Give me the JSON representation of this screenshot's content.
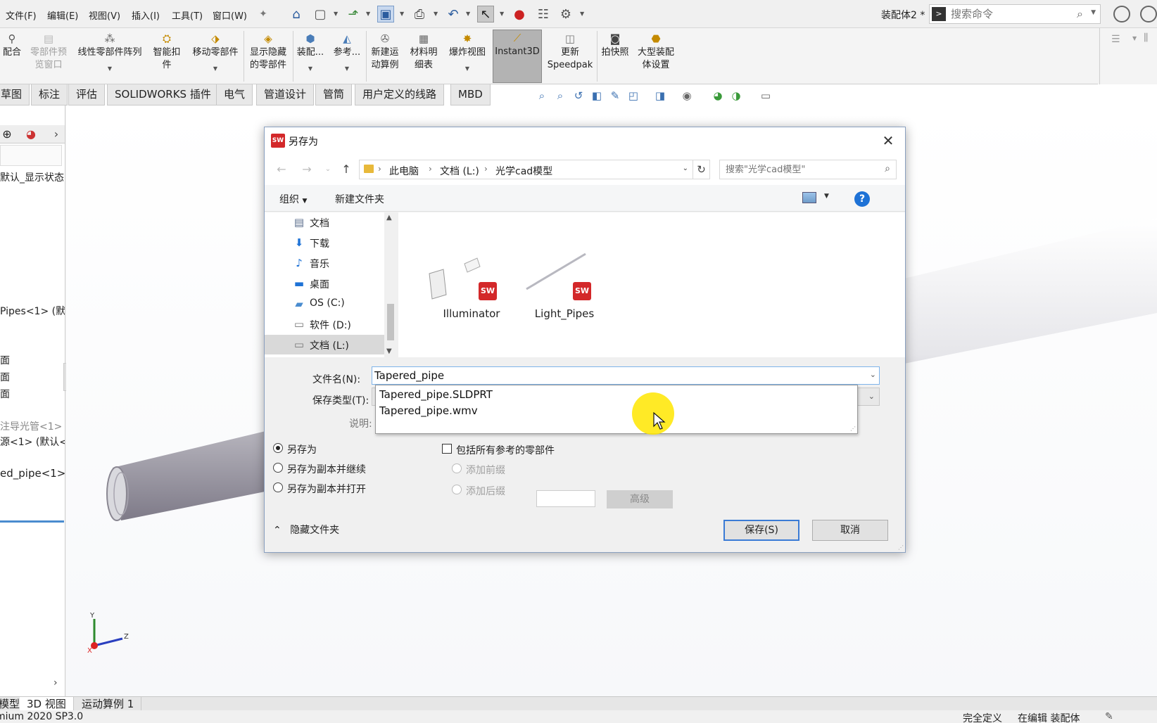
{
  "menubar": {
    "items": [
      "文件(F)",
      "编辑(E)",
      "视图(V)",
      "插入(I)",
      "工具(T)",
      "窗口(W)"
    ],
    "doc_title": "装配体2 *",
    "search_placeholder": "搜索命令",
    "icons": [
      "pin-icon",
      "home-icon",
      "new-file-icon",
      "open-icon",
      "save-icon",
      "print-icon",
      "undo-icon",
      "select-icon",
      "traffic-light-icon",
      "file-properties-icon",
      "options-gear-icon"
    ]
  },
  "ribbon": {
    "buttons": [
      {
        "label1": "配合",
        "label2": "",
        "icon": "paperclip-icon"
      },
      {
        "label1": "零部件预",
        "label2": "览窗口",
        "icon": "preview-window-icon",
        "disabled": true
      },
      {
        "label1": "线性零部件阵列",
        "label2": "",
        "icon": "linear-pattern-icon"
      },
      {
        "label1": "智能扣",
        "label2": "件",
        "icon": "smart-fastener-icon"
      },
      {
        "label1": "移动零部件",
        "label2": "",
        "icon": "move-component-icon"
      },
      {
        "label1": "显示隐藏",
        "label2": "的零部件",
        "icon": "show-hidden-icon"
      },
      {
        "label1": "装配...",
        "label2": "",
        "icon": "assembly-features-icon"
      },
      {
        "label1": "参考...",
        "label2": "",
        "icon": "reference-geometry-icon"
      },
      {
        "label1": "新建运",
        "label2": "动算例",
        "icon": "motion-study-icon"
      },
      {
        "label1": "材料明",
        "label2": "细表",
        "icon": "bom-icon"
      },
      {
        "label1": "爆炸视图",
        "label2": "",
        "icon": "exploded-view-icon"
      },
      {
        "label1": "Instant3D",
        "label2": "",
        "icon": "instant3d-icon"
      },
      {
        "label1": "更新",
        "label2": "Speedpak",
        "icon": "speedpak-icon"
      },
      {
        "label1": "拍快照",
        "label2": "",
        "icon": "camera-icon"
      },
      {
        "label1": "大型装配",
        "label2": "体设置",
        "icon": "large-assembly-icon"
      }
    ]
  },
  "command_tabs": [
    "草图",
    "标注",
    "评估",
    "SOLIDWORKS 插件",
    "电气",
    "管道设计",
    "管筒",
    "用户定义的线路",
    "MBD"
  ],
  "left_panel": {
    "display_state": "默认_显示状态",
    "items": [
      {
        "text": "Pipes<1> (默"
      },
      {
        "text": "面"
      },
      {
        "text": "面"
      },
      {
        "text": "面"
      },
      {
        "text": "注导光管<1>",
        "muted": true
      },
      {
        "text": "源<1> (默认<"
      },
      {
        "text": "ed_pipe<1>"
      }
    ]
  },
  "dialog": {
    "title": "另存为",
    "address": [
      "此电脑",
      "文档 (L:)",
      "光学cad模型"
    ],
    "search_placeholder": "搜索\"光学cad模型\"",
    "organize": "组织",
    "new_folder": "新建文件夹",
    "nav_items": [
      {
        "label": "文档",
        "icon": "documents-icon"
      },
      {
        "label": "下载",
        "icon": "download-icon"
      },
      {
        "label": "音乐",
        "icon": "music-icon"
      },
      {
        "label": "桌面",
        "icon": "desktop-icon"
      },
      {
        "label": "OS (C:)",
        "icon": "drive-c-icon"
      },
      {
        "label": "软件 (D:)",
        "icon": "drive-icon"
      },
      {
        "label": "文档 (L:)",
        "icon": "drive-icon",
        "selected": true
      }
    ],
    "files": [
      {
        "name": "Illuminator",
        "icon": "sldasm-file-icon"
      },
      {
        "name": "Light_Pipes",
        "icon": "sldasm-file-icon"
      }
    ],
    "filename_label": "文件名(N):",
    "filename_value": "Tapered_pipe",
    "filetype_label": "保存类型(T):",
    "description_label": "说明:",
    "autocomplete": [
      "Tapered_pipe.SLDPRT",
      "Tapered_pipe.wmv"
    ],
    "save_options": [
      {
        "label": "另存为",
        "checked": true
      },
      {
        "label": "另存为副本并继续",
        "checked": false
      },
      {
        "label": "另存为副本并打开",
        "checked": false
      }
    ],
    "include_refs": "包括所有参考的零部件",
    "prefix_options": [
      "添加前缀",
      "添加后缀"
    ],
    "advanced": "高级",
    "hide_folders": "隐藏文件夹",
    "save": "保存(S)",
    "cancel": "取消"
  },
  "bottom_tabs": [
    "模型",
    "3D 视图",
    "运动算例 1"
  ],
  "status": {
    "left": "mium 2020 SP3.0",
    "right1": "完全定义",
    "right2": "在编辑 装配体"
  },
  "colors": {
    "accent": "#3a7bd5",
    "sw_red": "#d3282a",
    "cursor_highlight": "#ffe600"
  }
}
